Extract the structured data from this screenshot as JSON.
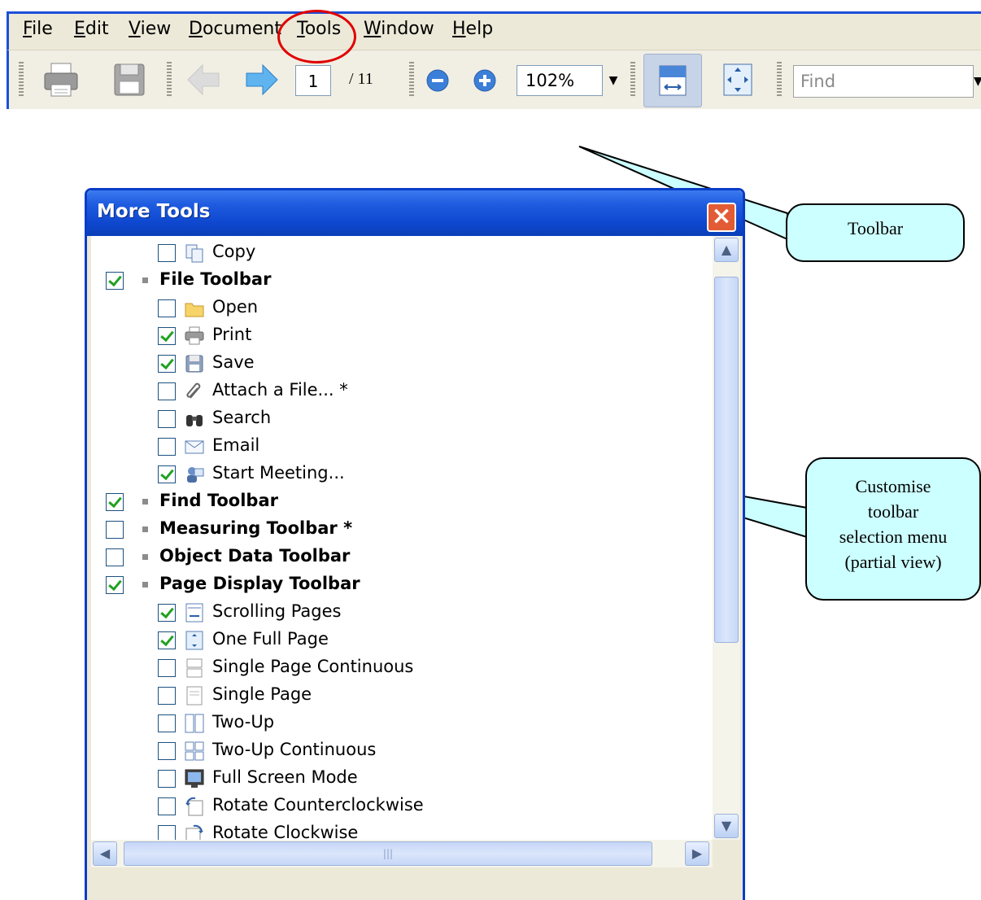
{
  "menubar": {
    "items": [
      "File",
      "Edit",
      "View",
      "Document",
      "Tools",
      "Window",
      "Help"
    ],
    "accel": [
      "F",
      "E",
      "V",
      "D",
      "T",
      "W",
      "H"
    ],
    "rest": [
      "ile",
      "dit",
      "iew",
      "ocument",
      "ools",
      "indow",
      "elp"
    ]
  },
  "toolbar": {
    "page_current": "1",
    "page_total": "/ 11",
    "zoom": "102%",
    "find_placeholder": "Find"
  },
  "callouts": {
    "toolbar": "Toolbar",
    "customise_lines": [
      "Customise",
      "toolbar",
      "selection menu",
      "(partial view)"
    ]
  },
  "dialog": {
    "title": "More Tools",
    "close": "×",
    "items": [
      {
        "label": "Copy",
        "checked": false,
        "level": 1,
        "icon": "copy-icon"
      },
      {
        "label": "File Toolbar",
        "checked": true,
        "level": 0,
        "icon": "bullet"
      },
      {
        "label": "Open",
        "checked": false,
        "level": 1,
        "icon": "folder-icon"
      },
      {
        "label": "Print",
        "checked": true,
        "level": 1,
        "icon": "printer-icon"
      },
      {
        "label": "Save",
        "checked": true,
        "level": 1,
        "icon": "floppy-icon"
      },
      {
        "label": "Attach a File... *",
        "checked": false,
        "level": 1,
        "icon": "paperclip-icon"
      },
      {
        "label": "Search",
        "checked": false,
        "level": 1,
        "icon": "binoculars-icon"
      },
      {
        "label": "Email",
        "checked": false,
        "level": 1,
        "icon": "email-icon"
      },
      {
        "label": "Start Meeting...",
        "checked": true,
        "level": 1,
        "icon": "meeting-icon"
      },
      {
        "label": "Find Toolbar",
        "checked": true,
        "level": 0,
        "icon": "bullet"
      },
      {
        "label": "Measuring Toolbar *",
        "checked": false,
        "level": 0,
        "icon": "bullet"
      },
      {
        "label": "Object Data Toolbar",
        "checked": false,
        "level": 0,
        "icon": "bullet"
      },
      {
        "label": "Page Display Toolbar",
        "checked": true,
        "level": 0,
        "icon": "bullet"
      },
      {
        "label": "Scrolling Pages",
        "checked": true,
        "level": 1,
        "icon": "scrolling-pages-icon"
      },
      {
        "label": "One Full Page",
        "checked": true,
        "level": 1,
        "icon": "one-full-page-icon"
      },
      {
        "label": "Single Page Continuous",
        "checked": false,
        "level": 1,
        "icon": "single-page-continuous-icon"
      },
      {
        "label": "Single Page",
        "checked": false,
        "level": 1,
        "icon": "single-page-icon"
      },
      {
        "label": "Two-Up",
        "checked": false,
        "level": 1,
        "icon": "two-up-icon"
      },
      {
        "label": "Two-Up Continuous",
        "checked": false,
        "level": 1,
        "icon": "two-up-continuous-icon"
      },
      {
        "label": "Full Screen Mode",
        "checked": false,
        "level": 1,
        "icon": "full-screen-icon"
      },
      {
        "label": "Rotate Counterclockwise",
        "checked": false,
        "level": 1,
        "icon": "rotate-ccw-icon"
      },
      {
        "label": "Rotate Clockwise",
        "checked": false,
        "level": 1,
        "icon": "rotate-cw-icon"
      }
    ]
  },
  "colors": {
    "title_bar": "#1f5ce0",
    "callout_fill": "#ccffff",
    "highlight_circle": "#e00000",
    "check_green": "#21a121"
  }
}
